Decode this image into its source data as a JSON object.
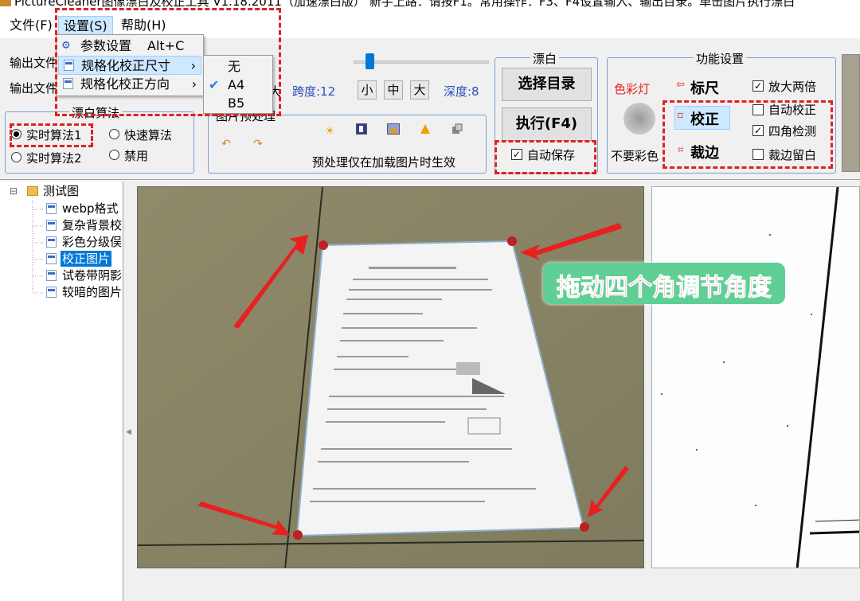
{
  "window": {
    "title": "PictureCleaner图像漂白及校正工具 V1.18.2011（加速漂白版）    新手上路：请按F1。常用操作：F3、F4设置输入、输出目录。单击图片执行漂白"
  },
  "menubar": {
    "file": "文件(F)",
    "settings": "设置(S)",
    "help": "帮助(H)"
  },
  "settings_menu": {
    "items": [
      {
        "label": "参数设置",
        "shortcut": "Alt+C"
      },
      {
        "label": "规格化校正尺寸",
        "submenu_arrow": "›"
      },
      {
        "label": "规格化校正方向",
        "submenu_arrow": "›"
      }
    ]
  },
  "size_submenu": {
    "items": [
      {
        "label": "无",
        "checked": false
      },
      {
        "label": "A4",
        "checked": true,
        "check_mark": "✔"
      },
      {
        "label": "B5",
        "checked": false
      }
    ]
  },
  "output": {
    "label1": "输出文件",
    "label2": "输出文件"
  },
  "brush": {
    "big_label": "大",
    "span_label": "跨度:12",
    "small": "小",
    "medium": "中",
    "large": "大",
    "depth_label": "深度:8"
  },
  "whitening_algo": {
    "title": "漂白算法",
    "options": [
      {
        "label": "实时算法1",
        "selected": true
      },
      {
        "label": "快速算法",
        "selected": false
      },
      {
        "label": "实时算法2",
        "selected": false
      },
      {
        "label": "禁用",
        "selected": false
      }
    ]
  },
  "preprocess": {
    "title": "图片预处理",
    "note": "预处理仅在加载图片时生效",
    "icons": [
      "undo-icon",
      "redo-icon",
      "brightness-icon",
      "contrast-icon",
      "image-adjust-icon",
      "warning-triangle-icon",
      "grayscale-icon"
    ]
  },
  "piaobai": {
    "title": "漂白",
    "select_dir": "选择目录",
    "execute": "执行(F4)",
    "auto_save": "自动保存",
    "auto_save_checked": true
  },
  "functions": {
    "title": "功能设置",
    "color_lamp": "色彩灯",
    "no_color": "不要彩色",
    "ruler": "标尺",
    "correct": "校正",
    "crop": "裁边",
    "double_zoom": "放大两倍",
    "double_zoom_checked": true,
    "auto_correct": "自动校正",
    "auto_correct_checked": false,
    "corner_detect": "四角检测",
    "corner_detect_checked": true,
    "crop_margin": "裁边留白",
    "crop_margin_checked": false
  },
  "tree": {
    "root": "测试图",
    "items": [
      {
        "label": "webp格式",
        "selected": false
      },
      {
        "label": "复杂背景校",
        "selected": false
      },
      {
        "label": "彩色分级俣",
        "selected": false
      },
      {
        "label": "校正图片",
        "selected": true
      },
      {
        "label": "试卷带阴影",
        "selected": false
      },
      {
        "label": "较暗的图片",
        "selected": false
      }
    ]
  },
  "annotation": {
    "callout": "拖动四个角调节角度",
    "callout_bg": "#5fcf95",
    "callout_text_color": "#e0204a"
  },
  "colors": {
    "dash_red": "#e02020",
    "group_border": "#7aa0cf",
    "selection_blue": "#0078d7",
    "label_blue": "#2a4fbf"
  }
}
